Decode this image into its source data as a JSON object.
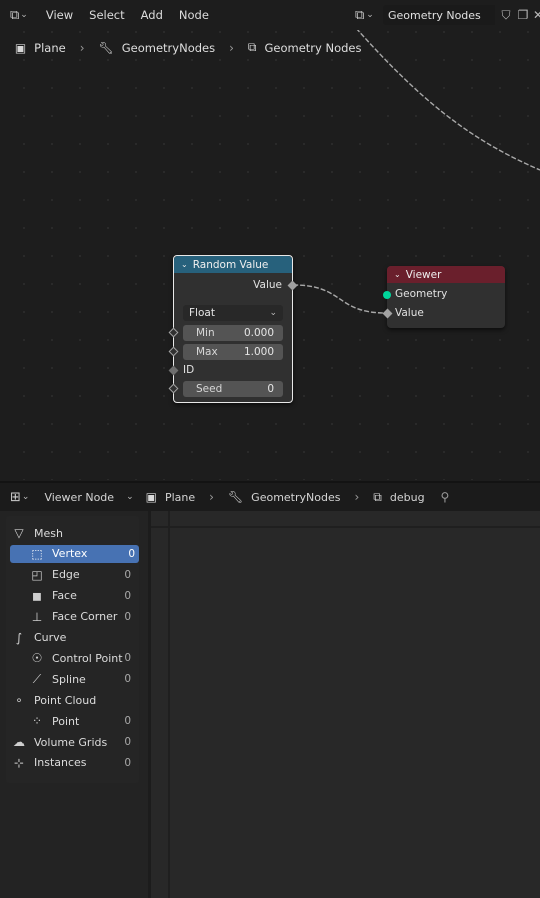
{
  "node_editor": {
    "header": {
      "editor_icon": "node-editor-icon",
      "menus": [
        "View",
        "Select",
        "Add",
        "Node"
      ],
      "node_tree": "Geometry Nodes"
    },
    "breadcrumb": {
      "object": "Plane",
      "modifier": "GeometryNodes",
      "tree": "Geometry Nodes"
    },
    "random_value_node": {
      "title": "Random Value",
      "output_label": "Value",
      "data_type": "Float",
      "min_label": "Min",
      "min_value": "0.000",
      "max_label": "Max",
      "max_value": "1.000",
      "id_label": "ID",
      "seed_label": "Seed",
      "seed_value": "0"
    },
    "viewer_node": {
      "title": "Viewer",
      "geometry_label": "Geometry",
      "value_label": "Value"
    },
    "colors": {
      "random_value_header": "#27617c",
      "viewer_header": "#6a1f2c",
      "geometry_socket": "#00d69b"
    }
  },
  "spreadsheet": {
    "header": {
      "editor_icon": "spreadsheet-icon",
      "mode": "Viewer Node",
      "object": "Plane",
      "modifier": "GeometryNodes",
      "viewer": "debug"
    },
    "domains": [
      {
        "label": "Mesh",
        "count": "",
        "icon": "mesh-icon"
      },
      {
        "label": "Vertex",
        "count": "0",
        "icon": "vertex-icon"
      },
      {
        "label": "Edge",
        "count": "0",
        "icon": "edge-icon"
      },
      {
        "label": "Face",
        "count": "0",
        "icon": "face-icon"
      },
      {
        "label": "Face Corner",
        "count": "0",
        "icon": "face-corner-icon"
      },
      {
        "label": "Curve",
        "count": "",
        "icon": "curve-icon"
      },
      {
        "label": "Control Point",
        "count": "0",
        "icon": "control-point-icon"
      },
      {
        "label": "Spline",
        "count": "0",
        "icon": "spline-icon"
      },
      {
        "label": "Point Cloud",
        "count": "",
        "icon": "point-cloud-icon"
      },
      {
        "label": "Point",
        "count": "0",
        "icon": "point-icon"
      },
      {
        "label": "Volume Grids",
        "count": "0",
        "icon": "volume-icon"
      },
      {
        "label": "Instances",
        "count": "0",
        "icon": "instances-icon"
      }
    ],
    "selected_color": "#4772b3"
  }
}
